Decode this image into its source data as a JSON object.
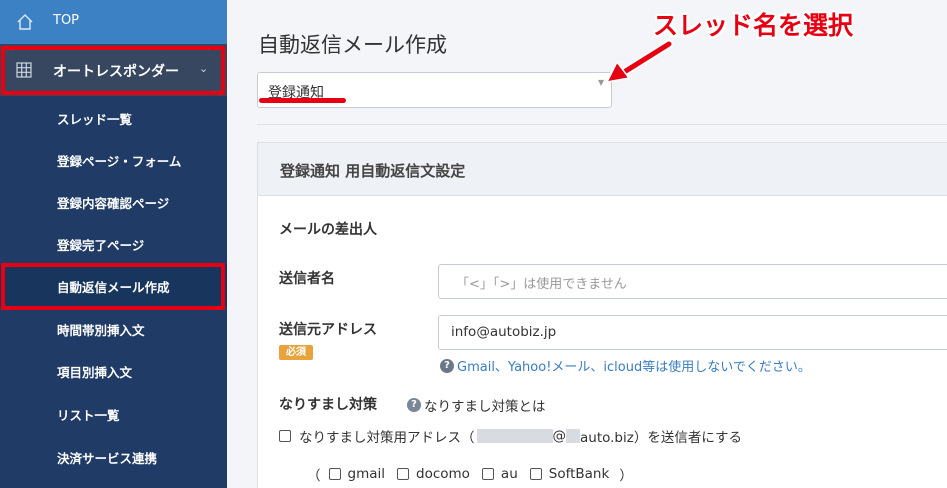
{
  "sidebar": {
    "top_label": "TOP",
    "section_label": "オートレスポンダー",
    "items": [
      {
        "label": "スレッド一覧"
      },
      {
        "label": "登録ページ・フォーム"
      },
      {
        "label": "登録内容確認ページ"
      },
      {
        "label": "登録完了ページ"
      },
      {
        "label": "自動返信メール作成"
      },
      {
        "label": "時間帯別挿入文"
      },
      {
        "label": "項目別挿入文"
      },
      {
        "label": "リスト一覧"
      },
      {
        "label": "決済サービス連携"
      }
    ]
  },
  "main": {
    "title": "自動返信メール作成",
    "thread_select_value": "登録通知",
    "annotation": "スレッド名を選択",
    "card_title": "登録通知 用自動返信文設定",
    "sender_section": "メールの差出人",
    "sender_name_label": "送信者名",
    "sender_name_placeholder": "「<」「>」は使用できません",
    "sender_address_label": "送信元アドレス",
    "required_badge": "必須",
    "sender_address_value": "info@autobiz.jp",
    "address_help": "Gmail、Yahoo!メール、icloud等は使用しないでください。",
    "spoof_label": "なりすまし対策",
    "spoof_help": "なりすまし対策とは",
    "spoof_checkbox_prefix": "なりすまし対策用アドレス（",
    "spoof_checkbox_at": "@",
    "spoof_checkbox_domain": "auto.biz）を送信者にする",
    "providers_open": "（",
    "providers": [
      "gmail",
      "docomo",
      "au",
      "SoftBank"
    ],
    "providers_close": "）"
  },
  "colors": {
    "sidebar_top": "#3c81c4",
    "sidebar_sub": "#1f3b66",
    "highlight_red": "#e60012",
    "badge_orange": "#e8a33d",
    "link_blue": "#3a7cc2"
  }
}
